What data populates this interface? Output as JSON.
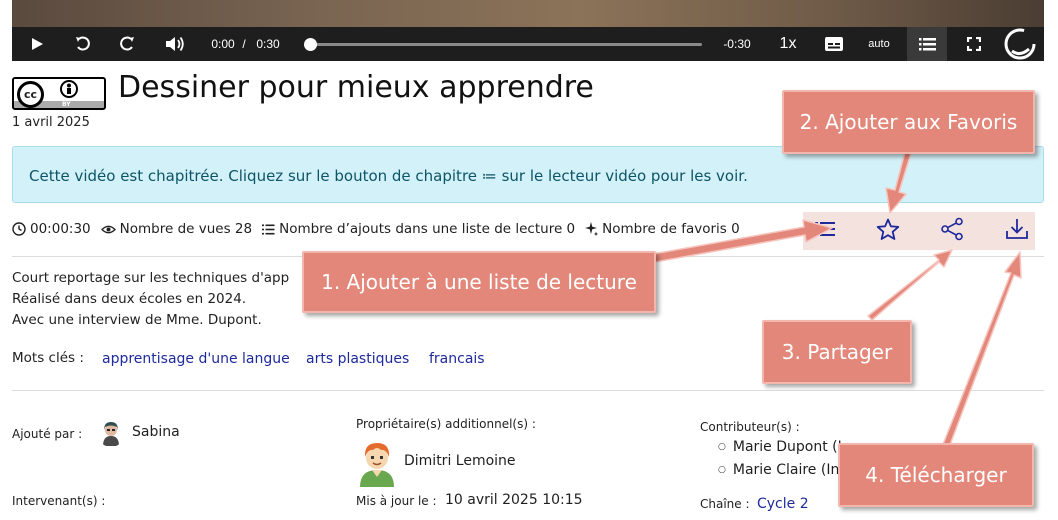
{
  "player": {
    "current_time": "0:00",
    "separator": "/",
    "duration": "0:30",
    "remaining": "-0:30",
    "speed": "1x",
    "quality": "auto",
    "progress_fraction": 0
  },
  "page": {
    "title": "Dessiner pour mieux apprendre",
    "date": "1 avril 2025",
    "license_badge": {
      "cc": "cc",
      "by": "BY"
    }
  },
  "banner": {
    "text_before": "Cette vidéo est chapitrée. Cliquez sur le bouton de chapitre",
    "icon": "≔",
    "text_after": "sur le lecteur vidéo pour les voir."
  },
  "stats": {
    "duration": "00:00:30",
    "views": "Nombre de vues 28",
    "playlist_adds": "Nombre d’ajouts dans une liste de lecture 0",
    "favorites": "Nombre de favoris 0"
  },
  "description": {
    "line1": "Court reportage sur les techniques d'app",
    "line2": "Réalisé dans deux écoles en 2024.",
    "line3": "Avec une interview de Mme. Dupont."
  },
  "keywords": {
    "label": "Mots clés :",
    "items": [
      "apprentisage d'une langue",
      "arts plastiques",
      "francais"
    ]
  },
  "meta": {
    "added_by_label": "Ajouté par :",
    "added_by_name": "Sabina",
    "owners_label": "Propriétaire(s) additionnel(s) :",
    "owner_name": "Dimitri Lemoine",
    "contributors_label": "Contributeur(s) :",
    "contributors": [
      "Marie Dupont (I",
      "Marie Claire (In"
    ],
    "speakers_label": "Intervenant(s) :",
    "updated_label": "Mis à jour le :",
    "updated_value": "10 avril 2025 10:15",
    "channel_label": "Chaîne :",
    "channel_value": "Cycle 2"
  },
  "callouts": {
    "c1": "1. Ajouter à une liste de lecture",
    "c2": "2. Ajouter aux Favoris",
    "c3": "3. Partager",
    "c4": "4. Télécharger"
  },
  "colors": {
    "callout": "#e3877a",
    "banner_bg": "#d3f1f8",
    "banner_text": "#0d5466",
    "link": "#1e2a9c",
    "action_bar_bg": "#f4e2df",
    "player_bg": "#1e1e1e"
  }
}
